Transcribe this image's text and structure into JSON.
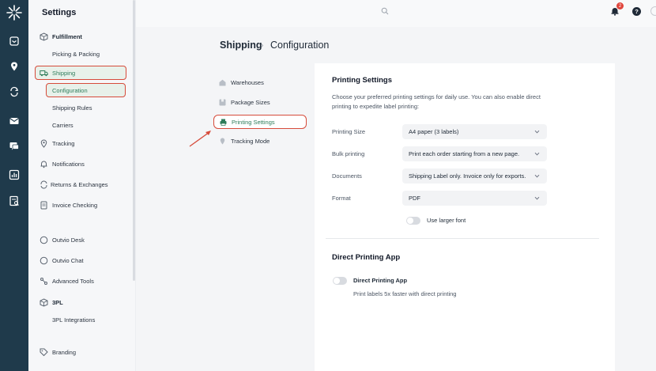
{
  "sidebar": {
    "title": "Settings",
    "items": [
      {
        "label": "Fulfillment",
        "icon": "cube-icon"
      },
      {
        "label": "Picking & Packing"
      },
      {
        "label": "Shipping",
        "icon": "truck-icon"
      },
      {
        "label": "Configuration"
      },
      {
        "label": "Shipping Rules"
      },
      {
        "label": "Carriers"
      },
      {
        "label": "Tracking",
        "icon": "location-pin-icon"
      },
      {
        "label": "Notifications",
        "icon": "bell-icon"
      },
      {
        "label": "Returns & Exchanges",
        "icon": "refresh-icon"
      },
      {
        "label": "Invoice Checking",
        "icon": "invoice-icon"
      },
      {
        "label": "Outvio Desk",
        "icon": "chat-bubble-icon"
      },
      {
        "label": "Outvio Chat",
        "icon": "chat-bubble-icon"
      },
      {
        "label": "Advanced Tools",
        "icon": "tools-icon"
      },
      {
        "label": "3PL",
        "icon": "cube-icon"
      },
      {
        "label": "3PL Integrations"
      },
      {
        "label": "Branding",
        "icon": "tag-icon"
      }
    ]
  },
  "topbar": {
    "notification_count": "2",
    "help_label": "?"
  },
  "breadcrumb": {
    "parent": "Shipping",
    "separator": "›",
    "current": "Configuration"
  },
  "subnav": [
    {
      "label": "Warehouses",
      "icon": "warehouse-icon"
    },
    {
      "label": "Package Sizes",
      "icon": "box-icon"
    },
    {
      "label": "Printing Settings",
      "icon": "printer-icon"
    },
    {
      "label": "Tracking Mode",
      "icon": "location-pin-icon"
    }
  ],
  "printing": {
    "heading": "Printing Settings",
    "description": "Choose your preferred printing settings for daily use. You can also enable direct printing to expedite label printing:",
    "fields": [
      {
        "label": "Printing Size",
        "value": "A4 paper (3 labels)"
      },
      {
        "label": "Bulk printing",
        "value": "Print each order starting from a new page."
      },
      {
        "label": "Documents",
        "value": "Shipping Label only. Invoice only for exports."
      },
      {
        "label": "Format",
        "value": "PDF"
      }
    ],
    "larger_font_label": "Use larger font"
  },
  "direct_app": {
    "heading": "Direct Printing App",
    "toggle_label": "Direct Printing App",
    "description": "Print labels 5x faster with direct printing"
  },
  "colors": {
    "rail": "#1f3a4b",
    "accent_green": "#2e7d5b",
    "highlight_red": "#d64b3b",
    "badge_red": "#e0453b"
  }
}
